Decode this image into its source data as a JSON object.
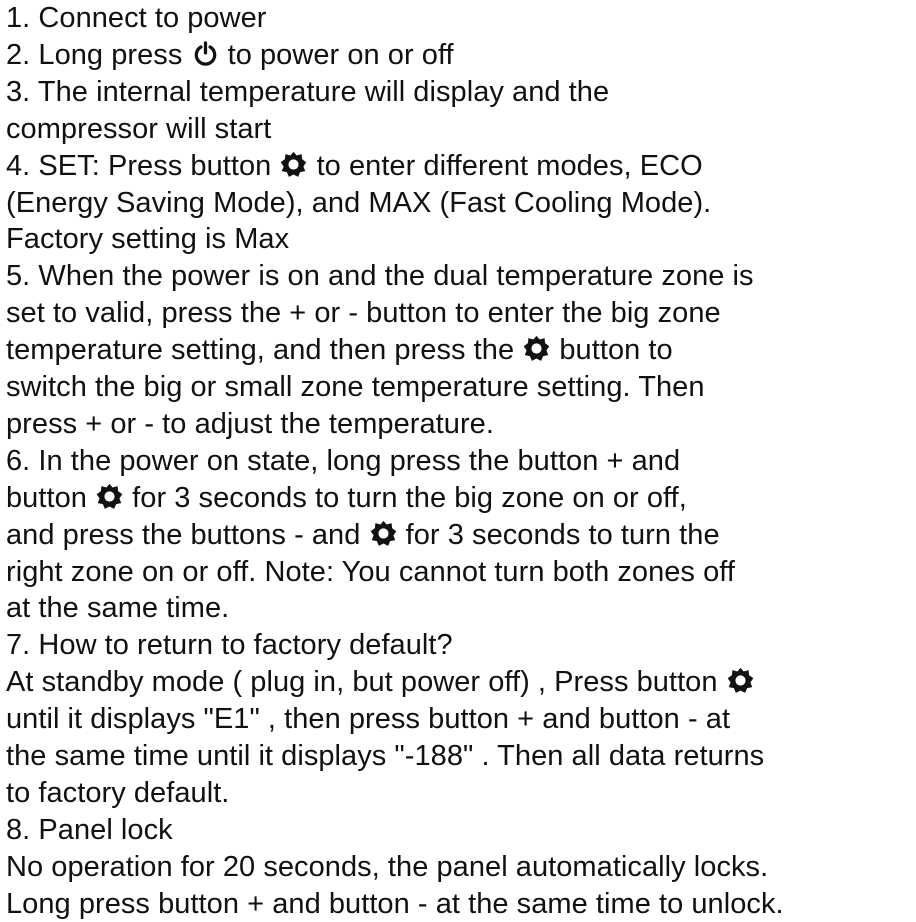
{
  "lines": [
    [
      "1. Connect to power"
    ],
    [
      "2. Long press ",
      {
        "icon": "power-icon"
      },
      " to power on or off"
    ],
    [
      "3. The internal temperature will display and the"
    ],
    [
      "compressor will start"
    ],
    [
      "4. SET: Press button ",
      {
        "icon": "gear-icon"
      },
      " to enter different modes, ECO"
    ],
    [
      "(Energy Saving Mode), and MAX (Fast Cooling Mode)."
    ],
    [
      "Factory setting is Max"
    ],
    [
      "5. When the power is on and the dual temperature zone is"
    ],
    [
      "set to valid, press the + or - button to enter the big zone"
    ],
    [
      "temperature setting, and then press the ",
      {
        "icon": "gear-icon"
      },
      " button to"
    ],
    [
      "switch the big or small zone temperature setting. Then"
    ],
    [
      "press + or - to adjust the temperature."
    ],
    [
      "6. In the power on state, long press the button + and"
    ],
    [
      "button ",
      {
        "icon": "gear-icon"
      },
      " for 3 seconds to turn the big zone on or off,"
    ],
    [
      "and press the buttons - and ",
      {
        "icon": "gear-icon"
      },
      " for 3 seconds to turn the"
    ],
    [
      "right zone on or off. Note: You cannot turn both zones off"
    ],
    [
      "at the same time."
    ],
    [
      "7. How to return to factory default?"
    ],
    [
      "At standby mode ( plug in, but power off) , Press button ",
      {
        "icon": "gear-icon"
      }
    ],
    [
      "until it displays \"E1\" , then press button + and button - at"
    ],
    [
      "the same time until it displays \"-188\" . Then all data returns"
    ],
    [
      "to factory default."
    ],
    [
      "8. Panel lock"
    ],
    [
      "No operation for 20 seconds, the panel automatically locks."
    ],
    [
      "Long press button + and button - at the same time to unlock."
    ]
  ]
}
